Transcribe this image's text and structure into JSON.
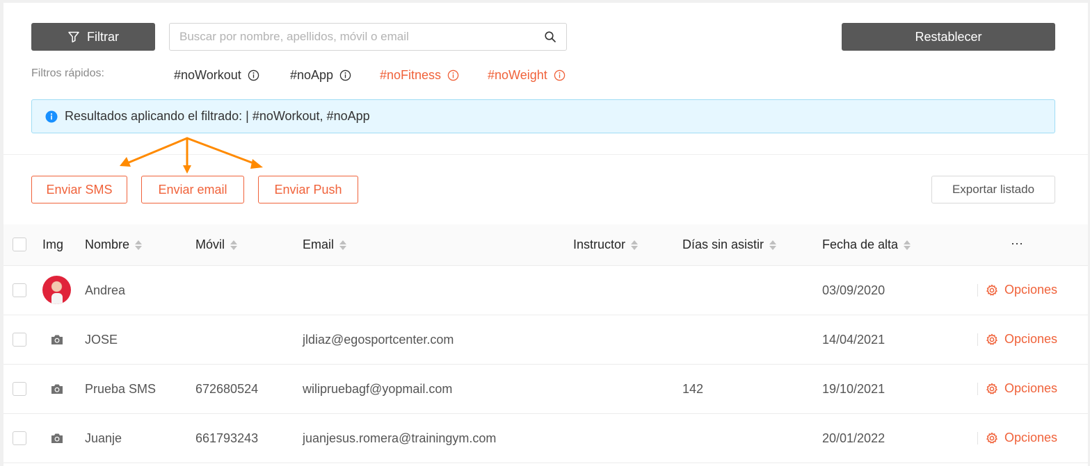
{
  "toolbar": {
    "filter_label": "Filtrar",
    "search_placeholder": "Buscar por nombre, apellidos, móvil o email",
    "reset_label": "Restablecer"
  },
  "quick_filters": {
    "label": "Filtros rápidos:",
    "items": [
      {
        "label": "#noWorkout",
        "state": "dark"
      },
      {
        "label": "#noApp",
        "state": "dark"
      },
      {
        "label": "#noFitness",
        "state": "orange"
      },
      {
        "label": "#noWeight",
        "state": "orange"
      }
    ]
  },
  "banner": {
    "text": "Resultados aplicando el filtrado: | #noWorkout, #noApp"
  },
  "actions": {
    "sms": "Enviar SMS",
    "email": "Enviar email",
    "push": "Enviar Push",
    "export": "Exportar listado"
  },
  "table": {
    "headers": {
      "img": "Img",
      "nombre": "Nombre",
      "movil": "Móvil",
      "email": "Email",
      "instructor": "Instructor",
      "dias": "Días sin asistir",
      "fecha": "Fecha de alta",
      "more": "···"
    },
    "options_label": "Opciones",
    "rows": [
      {
        "avatar": "photo",
        "nombre": "Andrea",
        "movil": "",
        "email": "",
        "instructor": "",
        "dias": "",
        "fecha": "03/09/2020"
      },
      {
        "avatar": "camera-icon",
        "nombre": "JOSE",
        "movil": "",
        "email": "jldiaz@egosportcenter.com",
        "instructor": "",
        "dias": "",
        "fecha": "14/04/2021"
      },
      {
        "avatar": "camera-icon",
        "nombre": "Prueba SMS",
        "movil": "672680524",
        "email": "wilipruebagf@yopmail.com",
        "instructor": "",
        "dias": "142",
        "fecha": "19/10/2021"
      },
      {
        "avatar": "camera-icon",
        "nombre": "Juanje",
        "movil": "661793243",
        "email": "juanjesus.romera@trainingym.com",
        "instructor": "",
        "dias": "",
        "fecha": "20/01/2022"
      }
    ]
  },
  "colors": {
    "accent": "#f0623a",
    "dark_button": "#585858",
    "banner_bg": "#e6f7ff",
    "info_blue": "#1890ff",
    "arrow": "#ff8a00"
  }
}
